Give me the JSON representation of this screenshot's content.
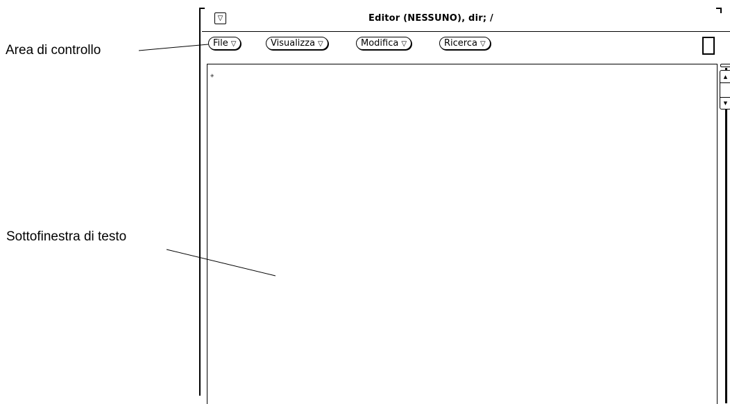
{
  "callouts": {
    "control_area": "Area di controllo",
    "text_subwindow": "Sottofinestra di testo"
  },
  "window": {
    "title": "Editor (NESSUNO), dir; /",
    "menu_button_glyph": "▽"
  },
  "menus": [
    {
      "label": "File",
      "arrow": "▽"
    },
    {
      "label": "Visualizza",
      "arrow": "▽"
    },
    {
      "label": "Modifica",
      "arrow": "▽"
    },
    {
      "label": "Ricerca",
      "arrow": "▽"
    }
  ],
  "text_pane": {
    "caret_glyph": "◈"
  },
  "scrollbar": {
    "up_glyph": "▲",
    "down_glyph": "▼"
  }
}
